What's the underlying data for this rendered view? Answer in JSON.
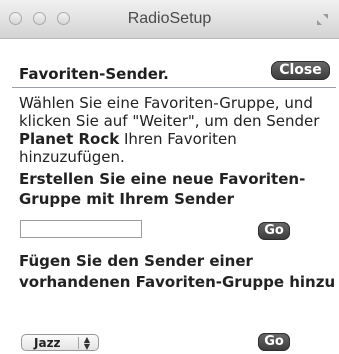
{
  "window": {
    "title": "RadioSetup"
  },
  "header": {
    "title": "Favoriten-Sender.",
    "close_label": "Close"
  },
  "intro": {
    "part1": "Wählen Sie eine Favoriten-Gruppe, und klicken Sie auf \"Weiter\", um den Sender ",
    "station": "Planet Rock",
    "part2": " Ihren Favoriten hinzuzufügen."
  },
  "create_group": {
    "heading": "Erstellen Sie eine neue Favoriten-Gruppe mit Ihrem Sender",
    "input_value": "",
    "go_label": "Go"
  },
  "add_existing": {
    "heading": "Fügen Sie den Sender einer vorhandenen Favoriten-Gruppe hinzu",
    "selected_group": "Jazz",
    "go_label": "Go"
  }
}
